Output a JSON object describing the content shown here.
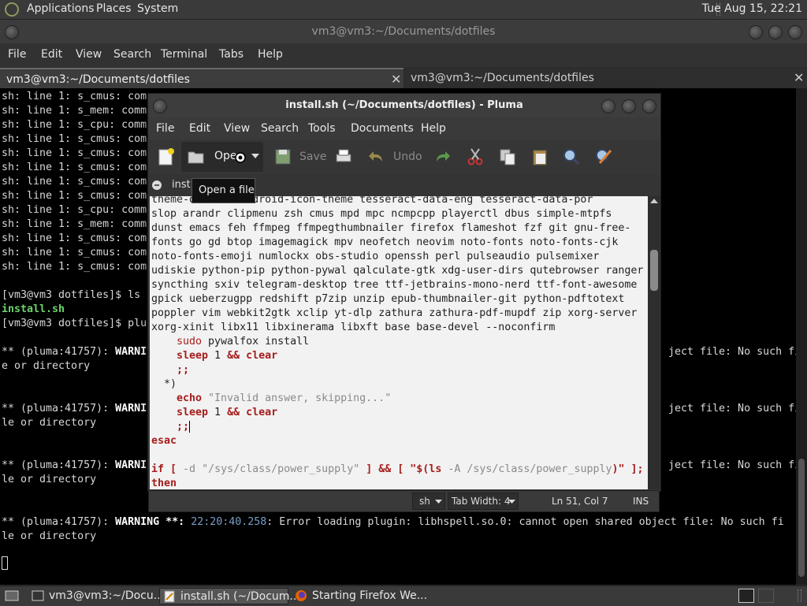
{
  "top_panel": {
    "applications": "Applications",
    "places": "Places",
    "system": "System",
    "clock": "Tue Aug 15, 22:21"
  },
  "terminal": {
    "title": "vm3@vm3:~/Documents/dotfiles",
    "menu": [
      "File",
      "Edit",
      "View",
      "Search",
      "Terminal",
      "Tabs",
      "Help"
    ],
    "tabs": [
      {
        "label": "vm3@vm3:~/Documents/dotfiles"
      },
      {
        "label": "vm3@vm3:~/Documents/dotfiles"
      }
    ],
    "close_glyph": "✕",
    "lines_left": [
      "sh: line 1: s_cmus: com",
      "sh: line 1: s_mem: comm",
      "sh: line 1: s_cpu: comm",
      "sh: line 1: s_cmus: com",
      "sh: line 1: s_cmus: com",
      "sh: line 1: s_cmus: com",
      "sh: line 1: s_cmus: com",
      "sh: line 1: s_cmus: com",
      "sh: line 1: s_cpu: comm",
      "sh: line 1: s_mem: comm",
      "sh: line 1: s_cmus: com",
      "sh: line 1: s_cmus: com",
      "sh: line 1: s_cmus: com"
    ],
    "prompt_ls": "[vm3@vm3 dotfiles]$ ls",
    "file_install": "install.sh",
    "prompt_plu": "[vm3@vm3 dotfiles]$ plu",
    "warn_prefix": "** (pluma:41757): ",
    "warn_word": "WARNI",
    "warn_tail": "ject file: No such fil",
    "warn_tail2": "ject file: No such fi",
    "dir_line1": "e or directory",
    "dir_line2": "le or directory",
    "last_warning": "WARNING",
    "last_stars": " **: ",
    "last_ts": "22:20:40.258",
    "last_msg": ": Error loading plugin: libhspell.so.0: cannot open shared object file: No such fi",
    "last_dir": "le or directory"
  },
  "pluma": {
    "title": "install.sh (~/Documents/dotfiles) - Pluma",
    "menu": [
      "File",
      "Edit",
      "View",
      "Search",
      "Tools",
      "Documents",
      "Help"
    ],
    "toolbar": {
      "open": "Ope",
      "save": "Save",
      "undo": "Undo"
    },
    "tab_label": "inst",
    "tooltip": "Open a file",
    "editor_lines": [
      "theme-d      rchdroid-icon-theme tesseract-data-eng tesseract-data-por",
      "slop arandr clipmenu zsh cmus mpd mpc ncmpcpp playerctl dbus simple-mtpfs",
      "dunst emacs feh ffmpeg ffmpegthumbnailer firefox flameshot fzf git gnu-free-",
      "fonts go gd btop imagemagick mpv neofetch neovim noto-fonts noto-fonts-cjk",
      "noto-fonts-emoji numlockx obs-studio openssh perl pulseaudio pulsemixer",
      "udiskie python-pip python-pywal qalculate-gtk xdg-user-dirs qutebrowser ranger",
      "syncthing sxiv telegram-desktop tree ttf-jetbrains-mono-nerd ttf-font-awesome",
      "gpick ueberzugpp redshift p7zip unzip epub-thumbnailer-git python-pdftotext",
      "poppler vim webkit2gtk xclip yt-dlp zathura zathura-pdf-mupdf zip xorg-server",
      "xorg-xinit libx11 libxinerama libxft base base-devel --noconfirm"
    ],
    "code": {
      "sudo": "sudo",
      "pywalfox": " pywalfox install",
      "sleep": "sleep",
      "sleep_rest": " 1 ",
      "amp": "&&",
      "clear": " clear",
      "dsemi": ";;",
      "star": "*)",
      "echo": "echo",
      "echo_str": " \"Invalid answer, skipping...\"",
      "esac": "esac",
      "if": "if",
      "br1": " [ ",
      "d": "-d",
      "path": " \"/sys/class/power_supply\"",
      "br2": " ] ",
      "amp2": "&&",
      "br3": " [ ",
      "sub_q": "\"",
      "sub": "$(ls",
      "la": " -A /sys/class/power_supply",
      "sub_end": ")\"",
      "br4": " ];",
      "then": "then"
    },
    "status": {
      "lang": "sh",
      "tab_width": "Tab Width:  4",
      "position": "Ln 51, Col 7",
      "mode": "INS"
    }
  },
  "taskbar": [
    {
      "label": "vm3@vm3:~/Docu..."
    },
    {
      "label": "install.sh (~/Docum..."
    },
    {
      "label": "Starting Firefox We..."
    }
  ]
}
